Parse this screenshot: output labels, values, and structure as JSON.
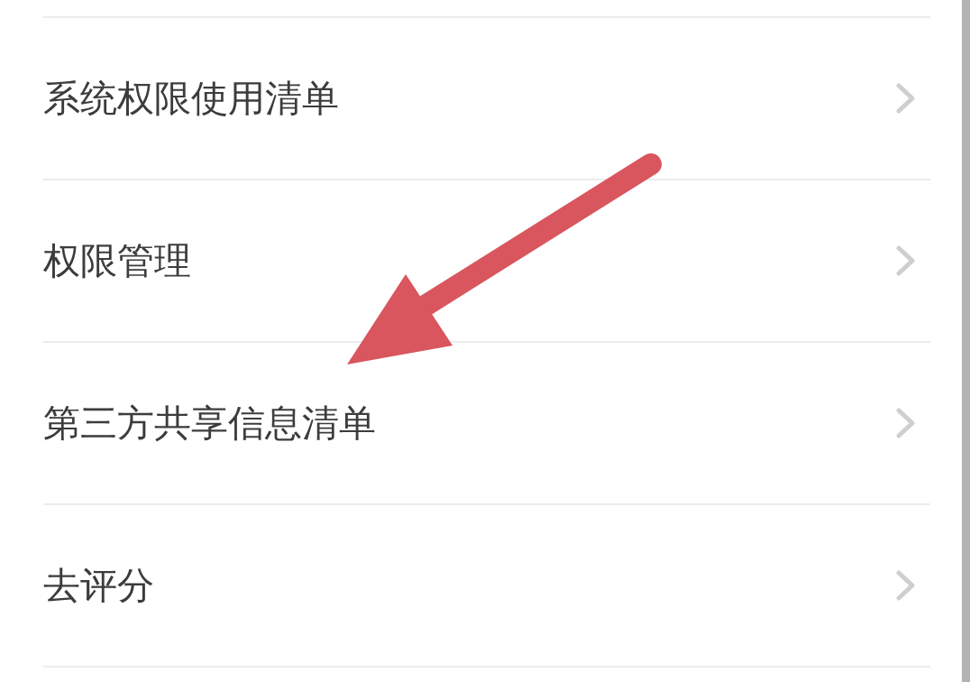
{
  "settings_list": {
    "items": [
      {
        "label": "系统权限使用清单"
      },
      {
        "label": "权限管理"
      },
      {
        "label": "第三方共享信息清单"
      },
      {
        "label": "去评分"
      }
    ]
  }
}
